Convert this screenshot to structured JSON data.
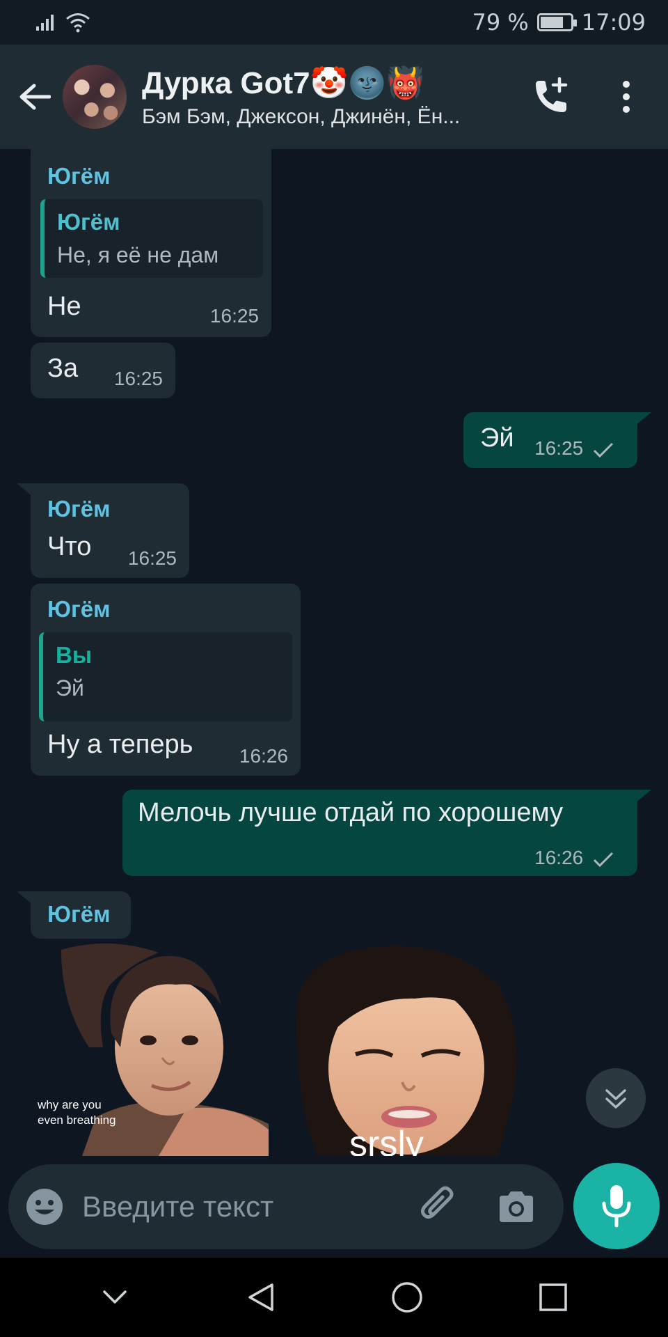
{
  "status_bar": {
    "battery": "79 %",
    "time": "17:09"
  },
  "header": {
    "title": "Дурка Got7",
    "title_emojis": "🤡🌚👹",
    "subtitle": "Бэм Бэм, Джексон, Джинён, Ён..."
  },
  "messages": [
    {
      "sender": "Югём",
      "quote_name": "Югём",
      "quote_text": "Не,  я её не дам",
      "text": "Не",
      "time": "16:25"
    },
    {
      "text": "За",
      "time": "16:25"
    },
    {
      "text": "Эй",
      "time": "16:25"
    },
    {
      "sender": "Югём",
      "text": "Что",
      "time": "16:25"
    },
    {
      "sender": "Югём",
      "quote_name": "Вы",
      "quote_text": "Эй",
      "text": "Ну а теперь",
      "time": "16:26"
    },
    {
      "text": "Мелочь лучше отдай по хорошему",
      "time": "16:26"
    },
    {
      "sender": "Югём"
    }
  ],
  "stickers": [
    {
      "caption_line1": "why are you",
      "caption_line2": "even breathing"
    },
    {
      "caption": "srsly"
    }
  ],
  "input": {
    "placeholder": "Введите текст"
  },
  "colors": {
    "background": "#0e1621",
    "incoming": "#1f2c34",
    "outgoing": "#054740",
    "accent": "#1ab3a6"
  }
}
